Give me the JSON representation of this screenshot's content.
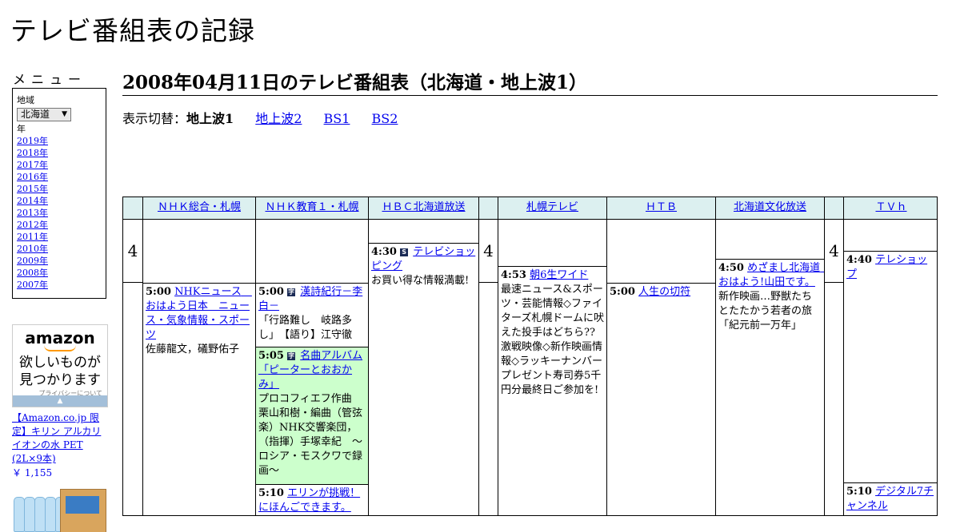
{
  "site": {
    "title": "テレビ番組表の記録"
  },
  "menu": {
    "heading": "メニュー",
    "region_label": "地域",
    "region_value": "北海道",
    "year_label": "年",
    "years": [
      "2019年",
      "2018年",
      "2017年",
      "2016年",
      "2015年",
      "2014年",
      "2013年",
      "2012年",
      "2011年",
      "2010年",
      "2009年",
      "2008年",
      "2007年"
    ]
  },
  "ad": {
    "logo": "amazon",
    "tagline1": "欲しいものが",
    "tagline2": "見つかります",
    "privacy": "プライバシーについて",
    "product": "【Amazon.co.jp 限定】キリン アルカリイオンの水 PET (2L×9本)",
    "price": "￥ 1,155"
  },
  "page": {
    "title": "2008年04月11日のテレビ番組表（北海道・地上波1）",
    "switch_label": "表示切替：",
    "switch_current": "地上波1",
    "switch_links": [
      "地上波2",
      "BS1",
      "BS2"
    ]
  },
  "hour_label": "4",
  "channels": [
    {
      "name": "ＮＨＫ総合・札幌"
    },
    {
      "name": "ＮＨＫ教育１・札幌"
    },
    {
      "name": "ＨＢＣ北海道放送"
    },
    {
      "name": "札幌テレビ"
    },
    {
      "name": "ＨＴＢ"
    },
    {
      "name": "北海道文化放送"
    },
    {
      "name": "ＴＶｈ"
    }
  ],
  "programs": {
    "nhk1_500": {
      "time": "5:00",
      "title": "NHKニュース　おはよう日本　ニュース・気象情報・スポーツ",
      "desc": "佐藤龍文，礒野佑子"
    },
    "etv_500": {
      "time": "5:00",
      "badge": "字",
      "title": "漢詩紀行－李白－",
      "desc": "「行路難し　岐路多し」　【語り】江守徹"
    },
    "etv_505": {
      "time": "5:05",
      "badge": "字",
      "title": "名曲アルバム「ピーターとおおかみ」",
      "desc": "プロコフィエフ作曲　栗山和樹・編曲（管弦楽）NHK交響楽団，（指揮）手塚幸紀　～ロシア・モスクワで録画～"
    },
    "etv_510": {
      "time": "5:10",
      "title": "エリンが挑戦！にほんごできます。"
    },
    "hbc_430": {
      "time": "4:30",
      "badge": "S",
      "title": "テレビショッピング",
      "desc": "お買い得な情報満載!"
    },
    "stv_453": {
      "time": "4:53",
      "title": "朝6生ワイド",
      "desc": "最速ニュース&スポーツ・芸能情報◇ファイターズ札幌ドームに吠えた投手はどちら??激戦映像◇新作映画情報◇ラッキーナンバープレゼント寿司券5千円分最終日ご参加を!"
    },
    "htb_500": {
      "time": "5:00",
      "title": "人生の切符"
    },
    "uhb_450": {
      "time": "4:50",
      "title": "めざまし北海道　おはよう!山田です。",
      "desc": "新作映画…野獣たちとたたかう若者の旅「紀元前一万年」"
    },
    "tvh_440": {
      "time": "4:40",
      "title": "テレショップ"
    },
    "tvh_510": {
      "time": "5:10",
      "title": "デジタル7チャンネル"
    }
  }
}
